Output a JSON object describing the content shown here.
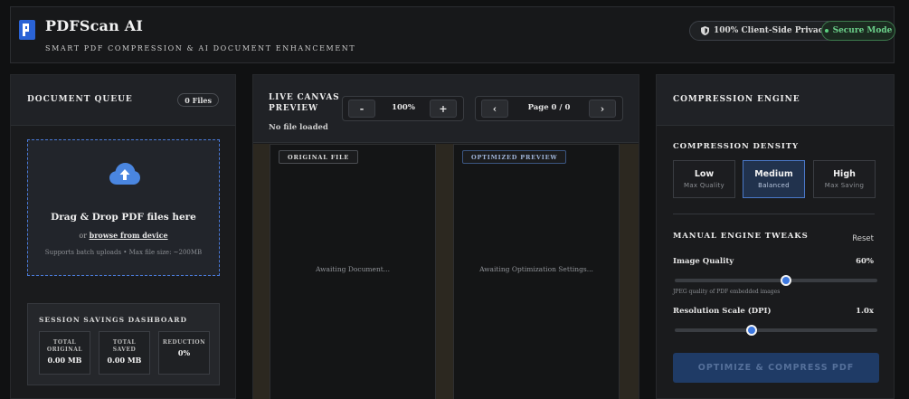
{
  "header": {
    "title": "PDFScan AI",
    "subtitle": "SMART PDF COMPRESSION & AI DOCUMENT ENHANCEMENT",
    "privacy_badge": "100% Client-Side Privacy",
    "secure_badge": "Secure Mode"
  },
  "queue": {
    "title": "DOCUMENT QUEUE",
    "files_count": "0 Files",
    "drop_title": "Drag & Drop PDF files here",
    "drop_or": "or",
    "browse_link": "browse from device",
    "drop_hint": "Supports batch uploads • Max file size: ~200MB"
  },
  "dashboard": {
    "title": "SESSION SAVINGS DASHBOARD",
    "stats": [
      {
        "label_line1": "TOTAL",
        "label_line2": "ORIGINAL",
        "value": "0.00 MB"
      },
      {
        "label_line1": "TOTAL",
        "label_line2": "SAVED",
        "value": "0.00 MB"
      },
      {
        "label_line1": "REDUCTION",
        "label_line2": "",
        "value": "0%"
      }
    ]
  },
  "preview": {
    "title": "LIVE CANVAS PREVIEW",
    "status": "No file loaded",
    "zoom_out": "-",
    "zoom_level": "100%",
    "zoom_in": "+",
    "prev_page": "‹",
    "page_indicator": "Page 0 / 0",
    "next_page": "›",
    "original_tag": "ORIGINAL FILE",
    "original_placeholder": "Awaiting Document...",
    "optimized_tag": "OPTIMIZED PREVIEW",
    "optimized_placeholder": "Awaiting Optimization Settings..."
  },
  "engine": {
    "title": "COMPRESSION ENGINE",
    "density_title": "COMPRESSION DENSITY",
    "options": [
      {
        "name": "Low",
        "sub": "Max Quality"
      },
      {
        "name": "Medium",
        "sub": "Balanced",
        "selected": true
      },
      {
        "name": "High",
        "sub": "Max Saving"
      }
    ],
    "tweaks_title": "MANUAL ENGINE TWEAKS",
    "reset_label": "Reset",
    "image_quality": {
      "label": "Image Quality",
      "value": "60%",
      "fraction": 0.55,
      "help": "JPEG quality of PDF embedded images"
    },
    "resolution": {
      "label": "Resolution Scale (DPI)",
      "value": "1.0x",
      "fraction": 0.38
    },
    "optimize_button": "OPTIMIZE & COMPRESS PDF"
  },
  "colors": {
    "accent": "#3d78e0",
    "secure_green": "#6cd08a",
    "background": "#101112"
  }
}
